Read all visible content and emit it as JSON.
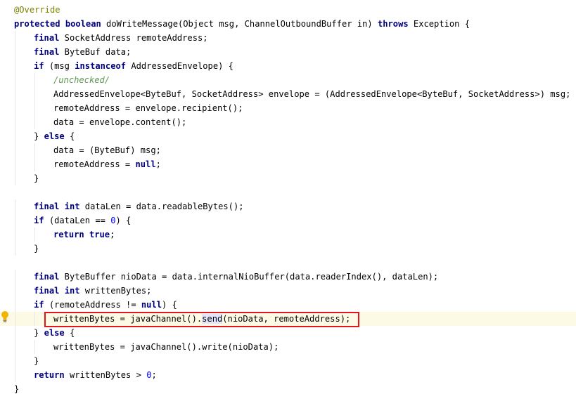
{
  "code": {
    "lines": [
      {
        "tokens": [
          {
            "t": "@Override",
            "c": "ann"
          }
        ]
      },
      {
        "tokens": [
          {
            "t": "protected",
            "c": "kw"
          },
          {
            "t": " "
          },
          {
            "t": "boolean",
            "c": "kw"
          },
          {
            "t": " doWriteMessage(Object msg, ChannelOutboundBuffer in) "
          },
          {
            "t": "throws",
            "c": "kw"
          },
          {
            "t": " Exception {"
          }
        ]
      },
      {
        "indent": 1,
        "tokens": [
          {
            "t": "final",
            "c": "kw"
          },
          {
            "t": " SocketAddress remoteAddress;"
          }
        ]
      },
      {
        "indent": 1,
        "tokens": [
          {
            "t": "final",
            "c": "kw"
          },
          {
            "t": " ByteBuf data;"
          }
        ]
      },
      {
        "indent": 1,
        "tokens": [
          {
            "t": "if",
            "c": "kw"
          },
          {
            "t": " (msg "
          },
          {
            "t": "instanceof",
            "c": "kw"
          },
          {
            "t": " AddressedEnvelope) {"
          }
        ]
      },
      {
        "indent": 2,
        "tokens": [
          {
            "t": "/unchecked/",
            "c": "cmt"
          }
        ]
      },
      {
        "indent": 2,
        "tokens": [
          {
            "t": "AddressedEnvelope<ByteBuf, SocketAddress> envelope = (AddressedEnvelope<ByteBuf, SocketAddress>) msg;"
          }
        ]
      },
      {
        "indent": 2,
        "tokens": [
          {
            "t": "remoteAddress = envelope.recipient();"
          }
        ]
      },
      {
        "indent": 2,
        "tokens": [
          {
            "t": "data = envelope.content();"
          }
        ]
      },
      {
        "indent": 1,
        "tokens": [
          {
            "t": "} "
          },
          {
            "t": "else",
            "c": "kw"
          },
          {
            "t": " {"
          }
        ]
      },
      {
        "indent": 2,
        "tokens": [
          {
            "t": "data = (ByteBuf) msg;"
          }
        ]
      },
      {
        "indent": 2,
        "tokens": [
          {
            "t": "remoteAddress = "
          },
          {
            "t": "null",
            "c": "kw"
          },
          {
            "t": ";"
          }
        ]
      },
      {
        "indent": 1,
        "tokens": [
          {
            "t": "}"
          }
        ]
      },
      {
        "tokens": []
      },
      {
        "indent": 1,
        "tokens": [
          {
            "t": "final",
            "c": "kw"
          },
          {
            "t": " "
          },
          {
            "t": "int",
            "c": "kw"
          },
          {
            "t": " dataLen = data.readableBytes();"
          }
        ]
      },
      {
        "indent": 1,
        "tokens": [
          {
            "t": "if",
            "c": "kw"
          },
          {
            "t": " (dataLen == "
          },
          {
            "t": "0",
            "c": "num"
          },
          {
            "t": ") {"
          }
        ]
      },
      {
        "indent": 2,
        "tokens": [
          {
            "t": "return",
            "c": "kw"
          },
          {
            "t": " "
          },
          {
            "t": "true",
            "c": "kw"
          },
          {
            "t": ";"
          }
        ]
      },
      {
        "indent": 1,
        "tokens": [
          {
            "t": "}"
          }
        ]
      },
      {
        "tokens": []
      },
      {
        "indent": 1,
        "tokens": [
          {
            "t": "final",
            "c": "kw"
          },
          {
            "t": " ByteBuffer nioData = data.internalNioBuffer(data.readerIndex(), dataLen);"
          }
        ]
      },
      {
        "indent": 1,
        "tokens": [
          {
            "t": "final",
            "c": "kw"
          },
          {
            "t": " "
          },
          {
            "t": "int",
            "c": "kw"
          },
          {
            "t": " writtenBytes;"
          }
        ]
      },
      {
        "indent": 1,
        "tokens": [
          {
            "t": "if",
            "c": "kw"
          },
          {
            "t": " (remoteAddress != "
          },
          {
            "t": "null",
            "c": "kw"
          },
          {
            "t": ") {"
          }
        ]
      },
      {
        "indent": 2,
        "current": true,
        "tokens": [
          {
            "t": "writtenBytes = javaChannel()."
          },
          {
            "t": "send",
            "c": "hl-send"
          },
          {
            "t": "(nioData, remoteAddress);"
          }
        ]
      },
      {
        "indent": 1,
        "tokens": [
          {
            "t": "} "
          },
          {
            "t": "else",
            "c": "kw"
          },
          {
            "t": " {"
          }
        ]
      },
      {
        "indent": 2,
        "tokens": [
          {
            "t": "writtenBytes = javaChannel().write(nioData);"
          }
        ]
      },
      {
        "indent": 1,
        "tokens": [
          {
            "t": "}"
          }
        ]
      },
      {
        "indent": 1,
        "tokens": [
          {
            "t": "return",
            "c": "kw"
          },
          {
            "t": " writtenBytes > "
          },
          {
            "t": "0",
            "c": "num"
          },
          {
            "t": ";"
          }
        ]
      },
      {
        "tokens": [
          {
            "t": "}"
          }
        ]
      }
    ]
  },
  "gutter": {
    "icon": "lightbulb-icon",
    "icon_color": "#f5b400"
  },
  "highlight": {
    "color": "#e0161c"
  }
}
